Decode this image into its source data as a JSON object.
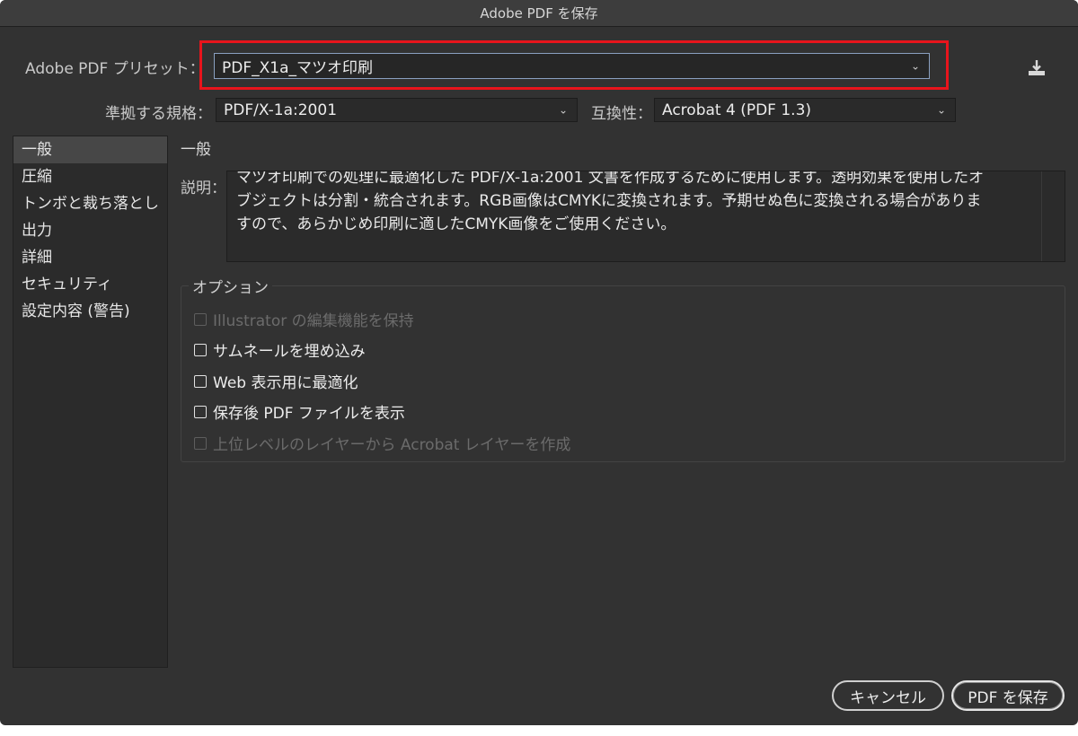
{
  "window": {
    "title": "Adobe PDF を保存"
  },
  "preset": {
    "label": "Adobe PDF プリセット：",
    "value": "PDF_X1a_マツオ印刷"
  },
  "standard": {
    "label": "準拠する規格：",
    "value": "PDF/X-1a:2001"
  },
  "compatibility": {
    "label": "互換性：",
    "value": "Acrobat 4 (PDF 1.3)"
  },
  "sidebar": {
    "items": [
      {
        "label": "一般"
      },
      {
        "label": "圧縮"
      },
      {
        "label": "トンボと裁ち落とし"
      },
      {
        "label": "出力"
      },
      {
        "label": "詳細"
      },
      {
        "label": "セキュリティ"
      },
      {
        "label": "設定内容 (警告)"
      }
    ]
  },
  "general": {
    "title": "一般",
    "description_label": "説明：",
    "description_lines": [
      "マツオ印刷での処理に最適化した PDF/X-1a:2001 文書を作成するために使用します。透明効果を使用したオ",
      "ブジェクトは分割・統合されます。RGB画像はCMYKに変換されます。予期せぬ色に変換される場合がありま",
      "すので、あらかじめ印刷に適したCMYK画像をご使用ください。"
    ]
  },
  "options": {
    "title": "オプション",
    "items": [
      {
        "label": "Illustrator の編集機能を保持",
        "enabled": false,
        "checked": false
      },
      {
        "label": "サムネールを埋め込み",
        "enabled": true,
        "checked": false
      },
      {
        "label": "Web 表示用に最適化",
        "enabled": true,
        "checked": false
      },
      {
        "label": "保存後 PDF ファイルを表示",
        "enabled": true,
        "checked": false
      },
      {
        "label": "上位レベルのレイヤーから Acrobat レイヤーを作成",
        "enabled": false,
        "checked": false
      }
    ]
  },
  "buttons": {
    "cancel": "キャンセル",
    "save": "PDF を保存"
  },
  "colors": {
    "window_bg": "#323232",
    "highlight": "#e8141c",
    "focus_border": "#8aa0c0"
  }
}
